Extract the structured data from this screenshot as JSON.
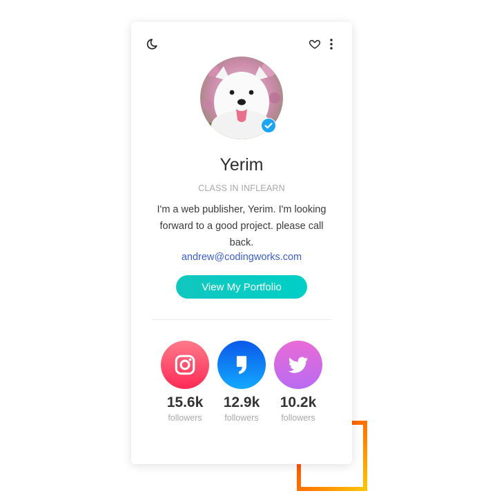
{
  "profile": {
    "name": "Yerim",
    "subtitle": "CLASS IN INFLEARN",
    "bio": "I'm a web publisher, Yerim. I'm looking forward to a good project. please call back.",
    "email": "andrew@codingworks.com",
    "cta_label": "View My Portfolio"
  },
  "toolbar": {
    "left_icon": "moon-icon",
    "right_icons": [
      "heart-icon",
      "more-vertical-icon"
    ]
  },
  "social": [
    {
      "network": "instagram",
      "icon": "instagram-icon",
      "count": "15.6k",
      "label": "followers"
    },
    {
      "network": "kakaostory",
      "icon": "kakaostory-icon",
      "count": "12.9k",
      "label": "followers"
    },
    {
      "network": "twitter",
      "icon": "twitter-icon",
      "count": "10.2k",
      "label": "followers"
    }
  ],
  "colors": {
    "accent": "#00c9c0",
    "link": "#3b5fc0",
    "verified_badge": "#1aa6f5",
    "instagram": "#ff3b5f",
    "kakaostory": "#0f7ff5",
    "twitter": "#cf6be6",
    "frame_gradient": [
      "#ff1f1f",
      "#ffc400"
    ]
  }
}
